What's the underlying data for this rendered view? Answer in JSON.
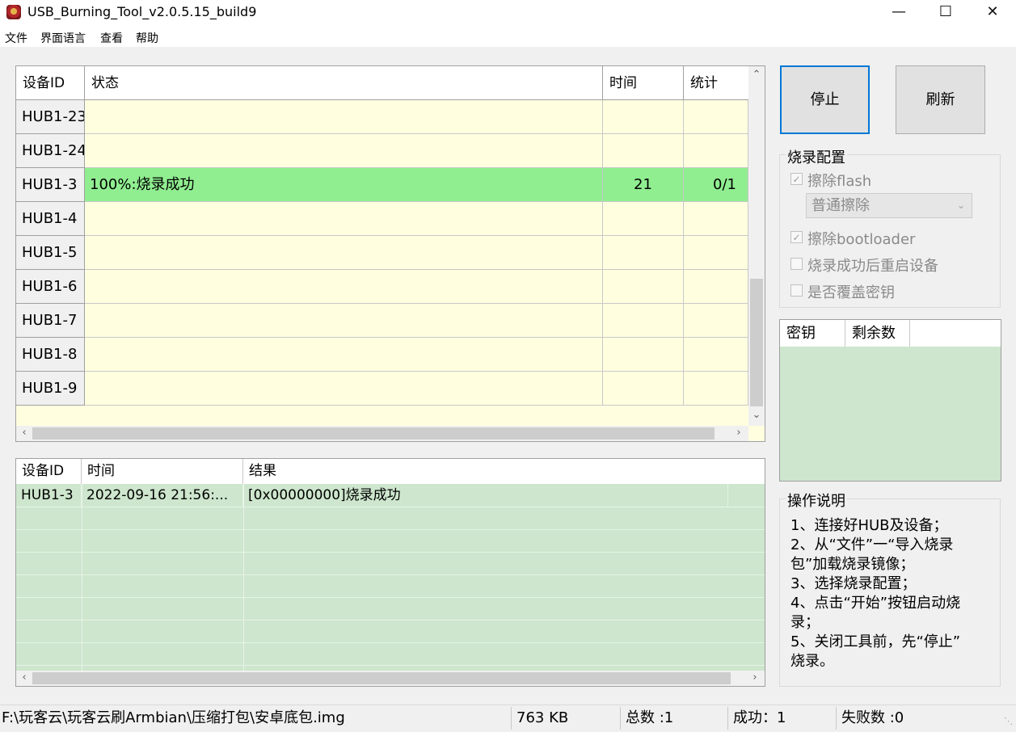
{
  "window": {
    "title": "USB_Burning_Tool_v2.0.5.15_build9"
  },
  "menu": [
    "文件",
    "界面语言",
    "查看",
    "帮助"
  ],
  "device_table": {
    "headers": {
      "id": "设备ID",
      "status": "状态",
      "time": "时间",
      "stats": "统计"
    },
    "rows": [
      {
        "id": "HUB1-23",
        "status": "",
        "time": "",
        "stats": ""
      },
      {
        "id": "HUB1-24",
        "status": "",
        "time": "",
        "stats": ""
      },
      {
        "id": "HUB1-3",
        "status": "100%:烧录成功",
        "time": "21",
        "stats": "0/1"
      },
      {
        "id": "HUB1-4",
        "status": "",
        "time": "",
        "stats": ""
      },
      {
        "id": "HUB1-5",
        "status": "",
        "time": "",
        "stats": ""
      },
      {
        "id": "HUB1-6",
        "status": "",
        "time": "",
        "stats": ""
      },
      {
        "id": "HUB1-7",
        "status": "",
        "time": "",
        "stats": ""
      },
      {
        "id": "HUB1-8",
        "status": "",
        "time": "",
        "stats": ""
      },
      {
        "id": "HUB1-9",
        "status": "",
        "time": "",
        "stats": ""
      }
    ]
  },
  "log_table": {
    "headers": {
      "id": "设备ID",
      "time": "时间",
      "result": "结果"
    },
    "rows": [
      {
        "id": "HUB1-3",
        "time": "2022-09-16 21:56:...",
        "result": "[0x00000000]烧录成功"
      }
    ]
  },
  "buttons": {
    "stop": "停止",
    "refresh": "刷新"
  },
  "burn_config": {
    "title": "烧录配置",
    "erase_flash": {
      "label": "擦除flash",
      "checked": true,
      "enabled": false
    },
    "erase_mode": {
      "selected": "普通擦除",
      "enabled": false
    },
    "erase_bootloader": {
      "label": "擦除bootloader",
      "checked": true,
      "enabled": false
    },
    "reboot_after": {
      "label": "烧录成功后重启设备",
      "checked": false,
      "enabled": false
    },
    "overwrite_key": {
      "label": "是否覆盖密钥",
      "checked": false,
      "enabled": false
    }
  },
  "key_table": {
    "headers": {
      "key": "密钥",
      "remaining": "剩余数"
    }
  },
  "instructions": {
    "title": "操作说明",
    "lines": [
      "1、连接好HUB及设备；",
      "2、从“文件”一“导入烧录",
      "包”加载烧录镜像；",
      "3、选择烧录配置；",
      "4、点击“开始”按钮启动烧",
      "录；",
      "5、关闭工具前，先“停止”",
      "烧录。"
    ]
  },
  "status_bar": {
    "path": "F:\\玩客云\\玩客云刷Armbian\\压缩打包\\安卓底包.img",
    "size": "763 KB",
    "total": "总数 :1",
    "success": "成功：1",
    "failed": "失败数 :0"
  },
  "colors": {
    "device_table_bg": "#ffffe0",
    "success_row": "#90ee90",
    "log_bg": "#cde6cd",
    "focus_border": "#0078d7"
  }
}
